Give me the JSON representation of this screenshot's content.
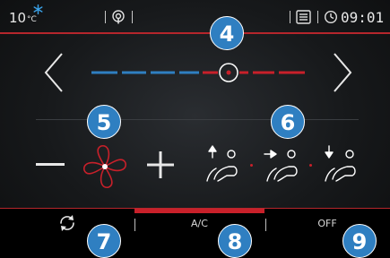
{
  "status": {
    "temperature": "10",
    "temp_unit": "°C",
    "time": "09:01",
    "icons": [
      "snowflake-icon",
      "radio-signal-icon",
      "phone-list-icon",
      "clock-icon"
    ]
  },
  "temperature_bar": {
    "cold_color": "#2f7fc1",
    "hot_color": "#c8202a",
    "prev_icon": "chevron-left-icon",
    "next_icon": "chevron-right-icon"
  },
  "fan": {
    "minus_icon": "minus-icon",
    "fan_icon": "fan-icon",
    "plus_icon": "plus-icon"
  },
  "air_distribution": {
    "modes": [
      "airflow-up-icon",
      "airflow-front-icon",
      "airflow-down-icon"
    ]
  },
  "bottom_bar": {
    "recirculation_icon": "recirculation-icon",
    "ac_label": "A/C",
    "off_label": "OFF"
  },
  "callouts": [
    "4",
    "5",
    "6",
    "7",
    "8",
    "9"
  ]
}
